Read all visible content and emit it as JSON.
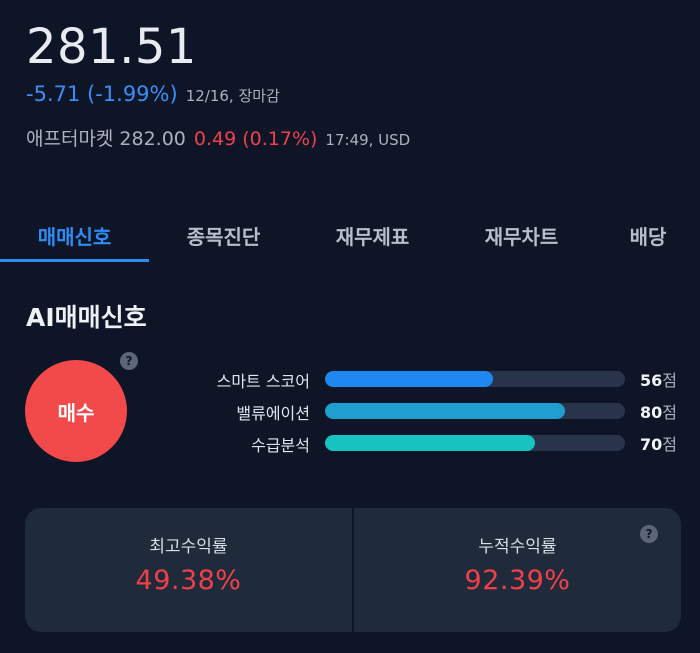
{
  "quote": {
    "price": "281.51",
    "change": "-5.71 (-1.99%)",
    "date": "12/16, 장마감",
    "after_label": "애프터마켓",
    "after_price": "282.00",
    "after_change": "0.49 (0.17%)",
    "after_time": "17:49, USD"
  },
  "tabs": [
    {
      "label": "매매신호",
      "active": true
    },
    {
      "label": "종목진단",
      "active": false
    },
    {
      "label": "재무제표",
      "active": false
    },
    {
      "label": "재무차트",
      "active": false
    },
    {
      "label": "배당",
      "active": false
    }
  ],
  "ai": {
    "title": "AI매매신호",
    "signal": "매수",
    "help_icon": "question-mark-icon",
    "unit": "점",
    "scores": [
      {
        "label": "스마트 스코어",
        "value": 56,
        "color": "#1f87f0"
      },
      {
        "label": "밸류에이션",
        "value": 80,
        "color": "#1e9fd0"
      },
      {
        "label": "수급분석",
        "value": 70,
        "color": "#17c3bf"
      }
    ]
  },
  "returns": {
    "max_label": "최고수익률",
    "max_value": "49.38%",
    "cum_label": "누적수익률",
    "cum_value": "92.39%"
  },
  "colors": {
    "background": "#0e1526",
    "accent": "#2f8cf5",
    "down": "#3a8ef6",
    "up": "#f0404a",
    "signal": "#f24a4a",
    "panel": "#1f2a3b"
  }
}
